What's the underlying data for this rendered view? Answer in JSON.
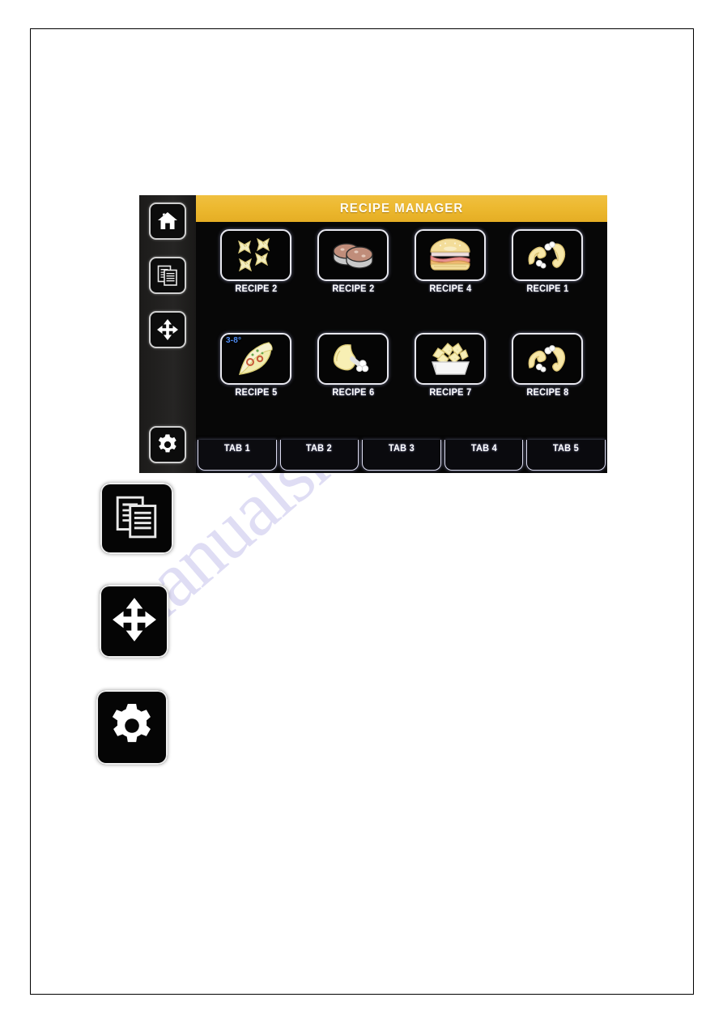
{
  "page": {
    "watermark_text": "manualshelf.com"
  },
  "device": {
    "header": {
      "title": "RECIPE MANAGER",
      "bar_color": "#edb930",
      "title_color": "#fffdf4"
    },
    "sidebar": {
      "items": [
        {
          "icon": "home-icon",
          "name": "sidebar-item-home"
        },
        {
          "icon": "copy-icon",
          "name": "sidebar-item-copy"
        },
        {
          "icon": "move-arrows-icon",
          "name": "sidebar-item-move"
        },
        {
          "icon": "gear-icon",
          "name": "sidebar-item-settings"
        }
      ]
    },
    "recipes": [
      {
        "label": "RECIPE 2",
        "icon": "farfalle-pasta-icon",
        "badge": ""
      },
      {
        "label": "RECIPE 2",
        "icon": "meat-patties-icon",
        "badge": ""
      },
      {
        "label": "RECIPE 4",
        "icon": "burger-icon",
        "badge": ""
      },
      {
        "label": "RECIPE 1",
        "icon": "chicken-wings-icon",
        "badge": ""
      },
      {
        "label": "RECIPE 5",
        "icon": "pizza-slice-icon",
        "badge": "3-8°"
      },
      {
        "label": "RECIPE 6",
        "icon": "drumstick-icon",
        "badge": ""
      },
      {
        "label": "RECIPE 7",
        "icon": "nugget-basket-icon",
        "badge": ""
      },
      {
        "label": "RECIPE 8",
        "icon": "chicken-wings-icon",
        "badge": ""
      }
    ],
    "tabs": [
      {
        "label": "TAB 1",
        "active": true
      },
      {
        "label": "TAB 2",
        "active": false
      },
      {
        "label": "TAB 3",
        "active": false
      },
      {
        "label": "TAB 4",
        "active": false
      },
      {
        "label": "TAB 5",
        "active": false
      }
    ],
    "badge_color": "#4f8ef7"
  },
  "callouts": [
    {
      "name": "callout-copy-icon",
      "icon": "copy-icon"
    },
    {
      "name": "callout-move-icon",
      "icon": "move-arrows-icon"
    },
    {
      "name": "callout-gear-icon",
      "icon": "gear-icon"
    }
  ]
}
